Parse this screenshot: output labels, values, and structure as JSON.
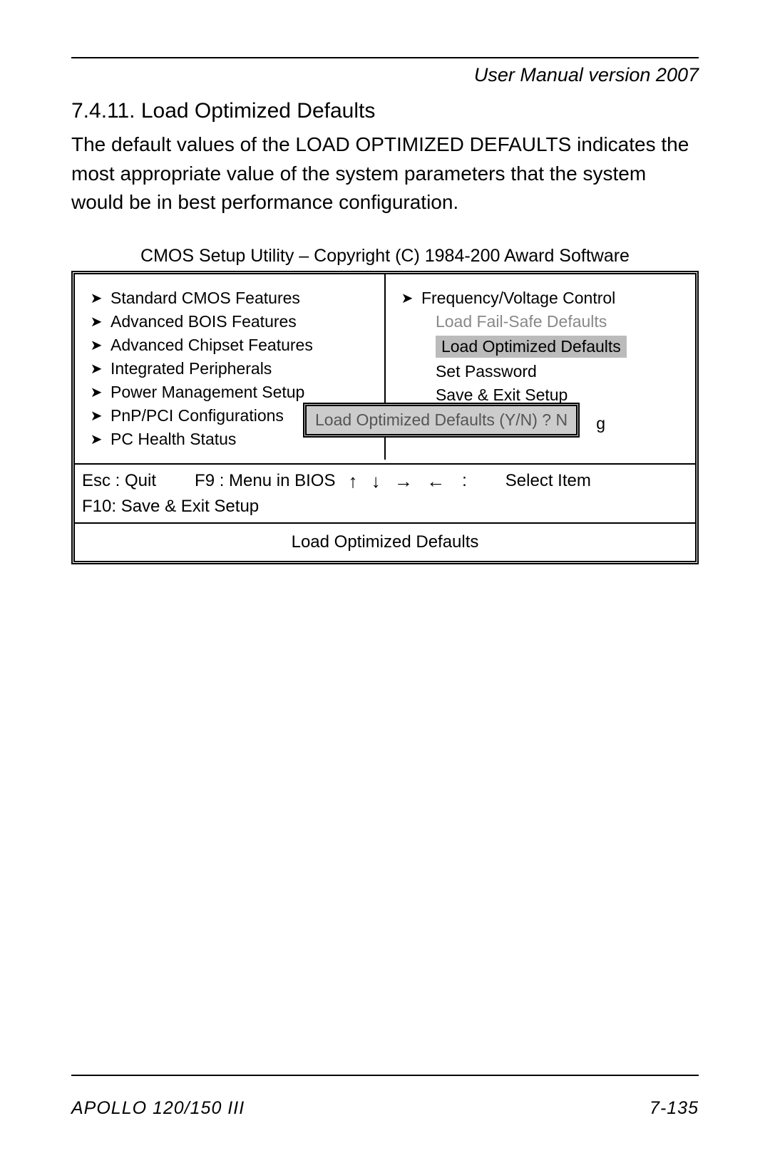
{
  "header": {
    "text": "User Manual version 2007"
  },
  "section": {
    "number_title": "7.4.11.  Load Optimized Defaults",
    "body": "The default values of the LOAD OPTIMIZED DEFAULTS indicates the most appropriate value of the system parameters that the system would be in best performance configuration."
  },
  "bios": {
    "title": "CMOS Setup Utility – Copyright (C) 1984-200 Award Software",
    "left_items": [
      "Standard CMOS Features",
      "Advanced BOIS Features",
      "Advanced Chipset Features",
      "Integrated Peripherals",
      "Power Management Setup",
      "PnP/PCI Configurations",
      "PC Health Status"
    ],
    "right": {
      "top_item": "Frequency/Voltage Control",
      "failsafe": "Load Fail-Safe Defaults",
      "optimized": "Load Optimized Defaults",
      "set_password": "Set Password",
      "save_exit": "Save & Exit Setup",
      "trailing_letter": "g"
    },
    "dialog": "Load Optimized Defaults (Y/N) ? N",
    "keys": {
      "esc": "Esc : Quit",
      "f9": "F9 : Menu in BIOS",
      "select": "Select Item",
      "f10": "F10: Save & Exit Setup"
    },
    "help_footer": "Load Optimized Defaults"
  },
  "footer": {
    "left": "APOLLO 120/150 III",
    "right": "7-135"
  }
}
